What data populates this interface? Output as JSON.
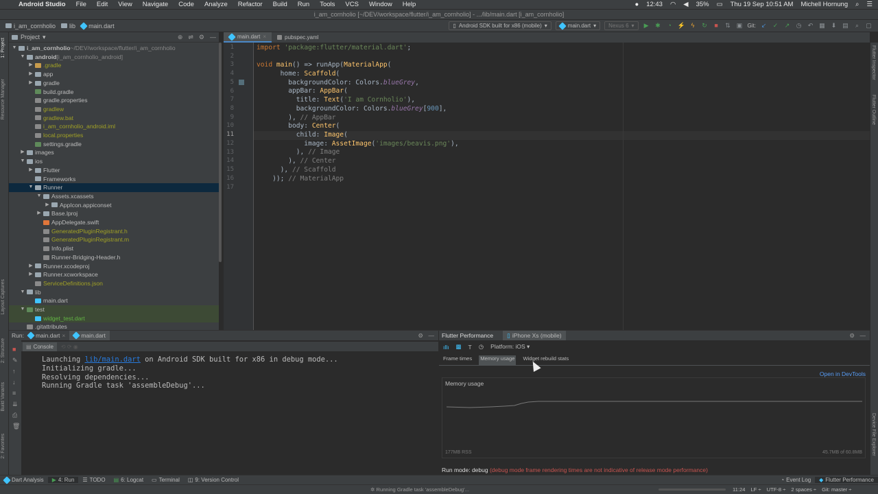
{
  "menubar": {
    "apple": "",
    "app": "Android Studio",
    "items": [
      "File",
      "Edit",
      "View",
      "Navigate",
      "Code",
      "Analyze",
      "Refactor",
      "Build",
      "Run",
      "Tools",
      "VCS",
      "Window",
      "Help"
    ],
    "clock_short": "12:43",
    "battery": "35%",
    "datetime": "Thu 19 Sep  10:51 AM",
    "user": "Michell Hornung"
  },
  "window_title": "i_am_cornholio [~/DEV/workspace/flutter/i_am_cornholio] - .../lib/main.dart [i_am_cornholio]",
  "navbar": {
    "crumbs": [
      "i_am_cornholio",
      "lib",
      "main.dart"
    ],
    "device_combo": "Android SDK built for x86 (mobile)",
    "config_combo": "main.dart",
    "emulator_combo": "Nexus 6",
    "git_label": "Git:"
  },
  "project_panel": {
    "title": "Project",
    "tree": [
      {
        "depth": 0,
        "arrow": "▼",
        "label": "i_am_cornholio",
        "suffix": " ~/DEV/workspace/flutter/i_am_cornholio",
        "color": "#bbbbbb",
        "bold": true,
        "icon": "#9aa7b0"
      },
      {
        "depth": 1,
        "arrow": "▼",
        "label": "android",
        "suffix": " [i_am_cornholio_android]",
        "color": "#bbbbbb",
        "bold": true,
        "icon": "#9aa7b0"
      },
      {
        "depth": 2,
        "arrow": "▶",
        "label": ".gradle",
        "color": "#a1a125",
        "icon": "#c79b4c"
      },
      {
        "depth": 2,
        "arrow": "▶",
        "label": "app",
        "color": "#bbbbbb",
        "icon": "#9aa7b0"
      },
      {
        "depth": 2,
        "arrow": "▶",
        "label": "gradle",
        "color": "#bbbbbb",
        "icon": "#9aa7b0"
      },
      {
        "depth": 2,
        "arrow": "",
        "label": "build.gradle",
        "color": "#bbbbbb",
        "icon": "#5f8a5a"
      },
      {
        "depth": 2,
        "arrow": "",
        "label": "gradle.properties",
        "color": "#bbbbbb",
        "icon": "#8a8a8a"
      },
      {
        "depth": 2,
        "arrow": "",
        "label": "gradlew",
        "color": "#a1a125",
        "icon": "#8a8a8a"
      },
      {
        "depth": 2,
        "arrow": "",
        "label": "gradlew.bat",
        "color": "#a1a125",
        "icon": "#8a8a8a"
      },
      {
        "depth": 2,
        "arrow": "",
        "label": "i_am_cornholio_android.iml",
        "color": "#a1a125",
        "icon": "#8a8a8a"
      },
      {
        "depth": 2,
        "arrow": "",
        "label": "local.properties",
        "color": "#a1a125",
        "icon": "#8a8a8a"
      },
      {
        "depth": 2,
        "arrow": "",
        "label": "settings.gradle",
        "color": "#bbbbbb",
        "icon": "#5f8a5a"
      },
      {
        "depth": 1,
        "arrow": "▶",
        "label": "images",
        "color": "#bbbbbb",
        "icon": "#9aa7b0"
      },
      {
        "depth": 1,
        "arrow": "▼",
        "label": "ios",
        "color": "#bbbbbb",
        "icon": "#9aa7b0"
      },
      {
        "depth": 2,
        "arrow": "▶",
        "label": "Flutter",
        "color": "#bbbbbb",
        "icon": "#9aa7b0"
      },
      {
        "depth": 2,
        "arrow": "",
        "label": "Frameworks",
        "color": "#bbbbbb",
        "icon": "#9aa7b0"
      },
      {
        "depth": 2,
        "arrow": "▼",
        "label": "Runner",
        "color": "#bbbbbb",
        "icon": "#9aa7b0",
        "sel": true
      },
      {
        "depth": 3,
        "arrow": "▼",
        "label": "Assets.xcassets",
        "color": "#bbbbbb",
        "icon": "#9aa7b0"
      },
      {
        "depth": 4,
        "arrow": "▶",
        "label": "AppIcon.appiconset",
        "color": "#bbbbbb",
        "icon": "#9aa7b0"
      },
      {
        "depth": 3,
        "arrow": "▶",
        "label": "Base.lproj",
        "color": "#bbbbbb",
        "icon": "#9aa7b0"
      },
      {
        "depth": 3,
        "arrow": "",
        "label": "AppDelegate.swift",
        "color": "#bbbbbb",
        "icon": "#e0763a"
      },
      {
        "depth": 3,
        "arrow": "",
        "label": "GeneratedPluginRegistrant.h",
        "color": "#a1a125",
        "icon": "#8a8a8a"
      },
      {
        "depth": 3,
        "arrow": "",
        "label": "GeneratedPluginRegistrant.m",
        "color": "#a1a125",
        "icon": "#8a8a8a"
      },
      {
        "depth": 3,
        "arrow": "",
        "label": "Info.plist",
        "color": "#bbbbbb",
        "icon": "#8a8a8a"
      },
      {
        "depth": 3,
        "arrow": "",
        "label": "Runner-Bridging-Header.h",
        "color": "#bbbbbb",
        "icon": "#8a8a8a"
      },
      {
        "depth": 2,
        "arrow": "▶",
        "label": "Runner.xcodeproj",
        "color": "#bbbbbb",
        "icon": "#9aa7b0"
      },
      {
        "depth": 2,
        "arrow": "▶",
        "label": "Runner.xcworkspace",
        "color": "#bbbbbb",
        "icon": "#9aa7b0"
      },
      {
        "depth": 2,
        "arrow": "",
        "label": "ServiceDefinitions.json",
        "color": "#a1a125",
        "icon": "#8a8a8a"
      },
      {
        "depth": 1,
        "arrow": "▼",
        "label": "lib",
        "color": "#bbbbbb",
        "icon": "#9aa7b0"
      },
      {
        "depth": 2,
        "arrow": "",
        "label": "main.dart",
        "color": "#bbbbbb",
        "icon": "#40c4ff"
      },
      {
        "depth": 1,
        "arrow": "▼",
        "label": "test",
        "color": "#bbbbbb",
        "icon": "#5f8a5a",
        "hl": true
      },
      {
        "depth": 2,
        "arrow": "",
        "label": "widget_test.dart",
        "color": "#62b543",
        "icon": "#40c4ff",
        "hl": true
      },
      {
        "depth": 1,
        "arrow": "",
        "label": ".gitattributes",
        "color": "#bbbbbb",
        "icon": "#8a8a8a"
      }
    ]
  },
  "left_strip": [
    "1: Project",
    "Resource Manager",
    "Layout Captures",
    "2: Structure",
    "Build Variants",
    "2: Favorites"
  ],
  "right_strip": [
    "Flutter Inspector",
    "Flutter Outline",
    "Device File Explorer"
  ],
  "editor": {
    "tabs": [
      {
        "label": "main.dart",
        "active": true
      },
      {
        "label": "pubspec.yaml",
        "active": false
      }
    ],
    "line_numbers": [
      "1",
      "2",
      "3",
      "4",
      "5",
      "6",
      "7",
      "8",
      "9",
      "10",
      "11",
      "12",
      "13",
      "14",
      "15",
      "16",
      "17"
    ],
    "current_line": 11
  },
  "run_panel": {
    "label": "Run:",
    "tabs": [
      "main.dart",
      "main.dart"
    ],
    "console_tab": "Console",
    "lines": [
      {
        "pre": "Launching ",
        "link": "lib/main.dart",
        "post": " on Android SDK built for x86 in debug mode..."
      },
      {
        "pre": "Initializing gradle...",
        "link": "",
        "post": ""
      },
      {
        "pre": "Resolving dependencies...",
        "link": "",
        "post": ""
      },
      {
        "pre": "Running Gradle task 'assembleDebug'...",
        "link": "",
        "post": ""
      }
    ]
  },
  "perf_panel": {
    "title": "Flutter Performance",
    "device": "iPhone Xs (mobile)",
    "platform": "Platform: iOS ▾",
    "tabs": [
      "Frame times",
      "Memory usage",
      "Widget rebuild stats"
    ],
    "active_tab": 1,
    "open_devtools": "Open in DevTools",
    "memory_title": "Memory usage",
    "rss": "177MB RSS",
    "heap": "45.7MB of 60.8MB",
    "run_mode_label": "Run mode: debug",
    "run_mode_warning": "(debug mode frame rendering times are not indicative of release mode performance)"
  },
  "tool_windows": {
    "left": [
      "Dart Analysis",
      "4: Run",
      "TODO",
      "6: Logcat",
      "Terminal",
      "9: Version Control"
    ],
    "right": [
      "Event Log",
      "Flutter Performance"
    ]
  },
  "status_bar": {
    "task": "Running Gradle task 'assembleDebug'...",
    "position": "11:24",
    "line_sep": "LF ÷",
    "encoding": "UTF-8 ÷",
    "indent": "2 spaces ÷",
    "git": "Git: master ÷"
  },
  "colors": {
    "accent": "#4a88c7",
    "selection": "#0d293e",
    "warning_red": "#c75450"
  }
}
